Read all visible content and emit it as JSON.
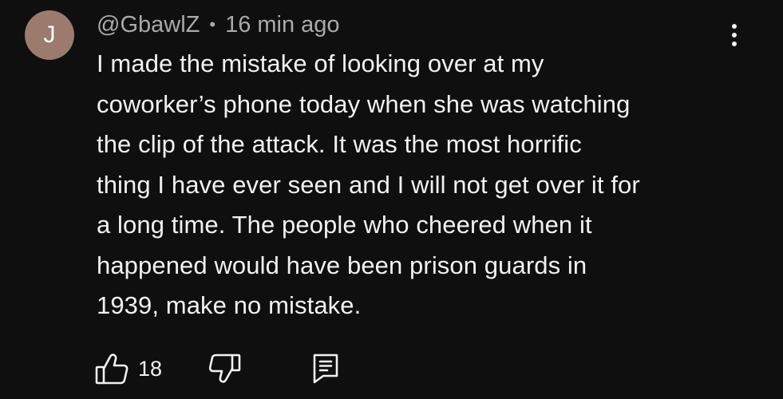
{
  "comment": {
    "avatar_letter": "J",
    "avatar_color": "#9c7b6e",
    "author": "@GbawlZ",
    "separator": "•",
    "timestamp": "16 min ago",
    "text": "I made the mistake of looking over at my\ncoworker’s phone today when she was watching\nthe clip of the attack. It was the most horrific\nthing I have ever seen and I will not get over it for\na long time. The people who cheered when it\nhappened would have been prison guards in\n1939, make no mistake.",
    "like_count": "18"
  },
  "icons": {
    "more": "more-vertical-icon",
    "like": "thumbs-up-icon",
    "dislike": "thumbs-down-icon",
    "reply": "comment-reply-icon"
  },
  "colors": {
    "background": "#0f0f0f",
    "text": "#f1f1f1",
    "secondary_text": "#aaaaaa"
  }
}
